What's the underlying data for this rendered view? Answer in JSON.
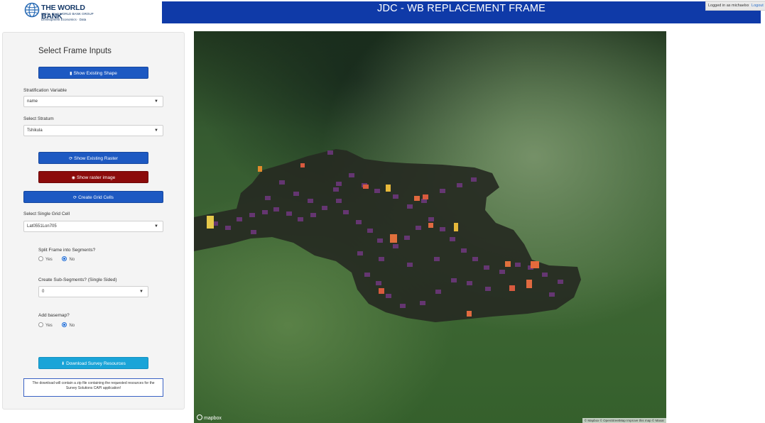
{
  "header": {
    "logo": {
      "name": "THE WORLD BANK",
      "line2": "IBRD · IDA | WORLD BANK GROUP",
      "line3": "Development Economics · Data"
    },
    "title": "JDC - WB REPLACEMENT FRAME",
    "user": {
      "logged_in": "Logged in as michaelxx",
      "logout": "Logout"
    }
  },
  "sidebar": {
    "title": "Select Frame Inputs",
    "show_shape_label": "Show Existing Shape",
    "stratification_label": "Stratification Variable",
    "stratification_value": "name",
    "stratum_label": "Select Stratum",
    "stratum_value": "Tshikula",
    "show_raster_label": "Show Existing Raster",
    "show_raster_image_label": "Show raster image",
    "create_grid_label": "Create Grid Cells",
    "grid_cell_label": "Select Single Grid Cell",
    "grid_cell_value": "Lat0551Lon705",
    "split_label": "Split Frame into Segments?",
    "split_yes": "Yes",
    "split_no": "No",
    "split_selected": "No",
    "subseg_label": "Create Sub-Segments? (Single Sided)",
    "subseg_value": "0",
    "basemap_label": "Add basemap?",
    "basemap_yes": "Yes",
    "basemap_no": "No",
    "basemap_selected": "No",
    "download_label": "Download Survey Resources",
    "note": "The download will contain a zip file containing the requested resources for the Survey Solutions CAPI application!"
  },
  "map": {
    "logo": "mapbox",
    "attribution": "© Mapbox © OpenStreetMap Improve this map © Maxar"
  },
  "icons": {
    "shape": "file-icon",
    "raster": "refresh-icon",
    "eye": "eye-icon",
    "grid": "refresh-icon",
    "download": "download-icon"
  },
  "colors": {
    "title_bar": "#0f3aa8",
    "primary_button": "#1d59c2",
    "danger_button": "#8c0b0b",
    "info_button": "#1aa4d8"
  }
}
